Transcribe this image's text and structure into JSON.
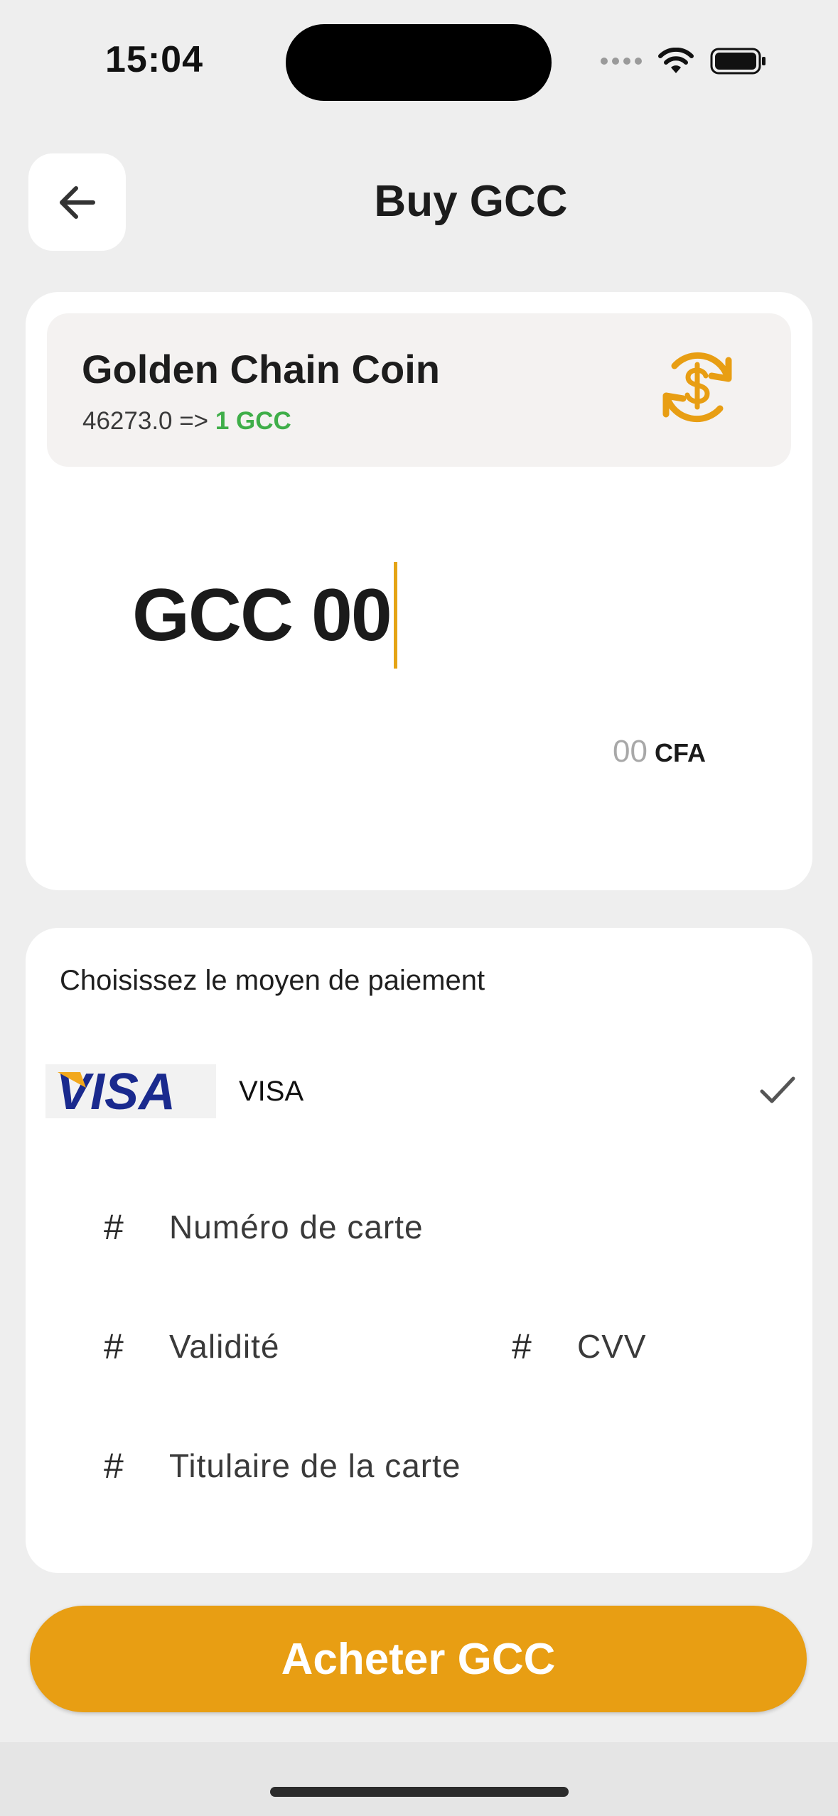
{
  "status_bar": {
    "time": "15:04"
  },
  "header": {
    "title": "Buy GCC",
    "back_icon": "arrow-left-icon"
  },
  "coin": {
    "name": "Golden Chain Coin",
    "rate_text": "46273.0 =>",
    "rate_gcc": "1 GCC",
    "icon": "currency-exchange-icon",
    "accent_color": "#e89e13",
    "rate_color": "#3fae49"
  },
  "amount": {
    "value": "GCC 00",
    "cfa_value": "00",
    "cfa_currency": "CFA"
  },
  "payment": {
    "title": "Choisissez le moyen de paiement",
    "method": {
      "logo_text": "VISA",
      "label": "VISA",
      "selected": true
    },
    "fields": {
      "card_number_placeholder": "Numéro de carte",
      "validity_placeholder": "Validité",
      "cvv_placeholder": "CVV",
      "holder_placeholder": "Titulaire de la carte",
      "prefix_symbol": "#"
    }
  },
  "actions": {
    "buy_label": "Acheter GCC",
    "buy_color": "#e89e13"
  }
}
